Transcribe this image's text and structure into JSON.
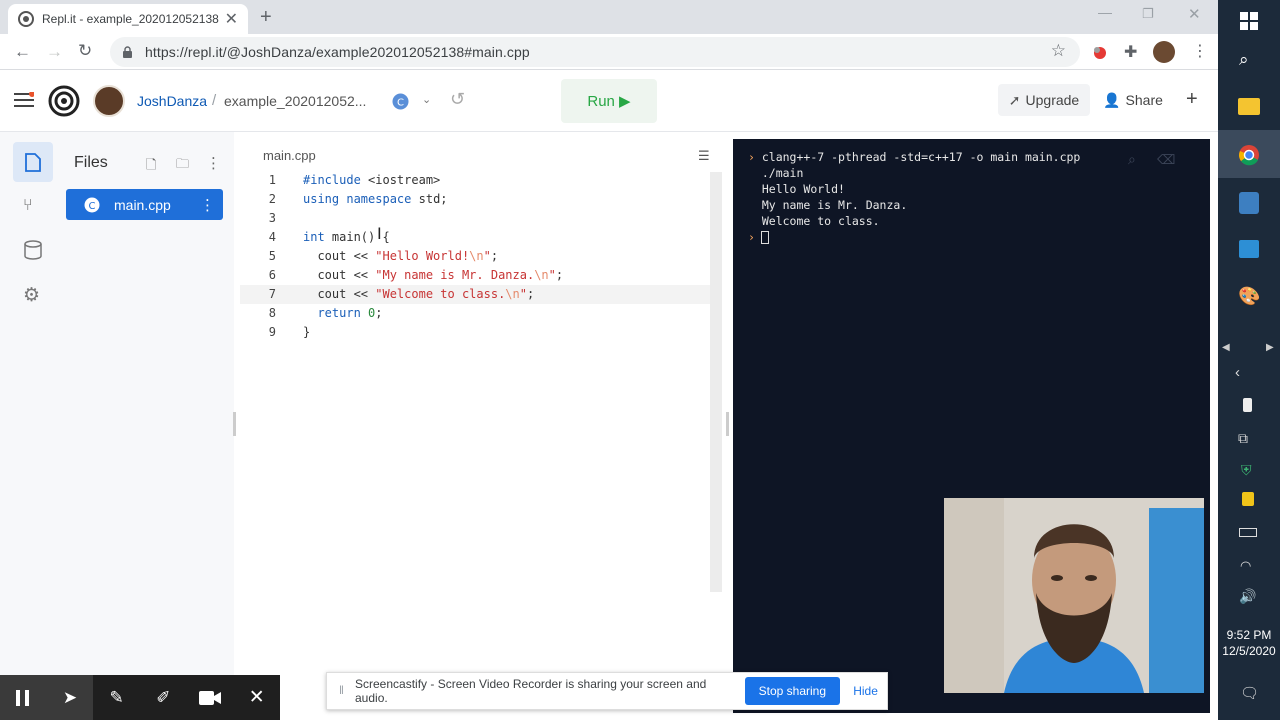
{
  "browser": {
    "tab_title": "Repl.it - example_202012052138",
    "url": "https://repl.it/@JoshDanza/example202012052138#main.cpp"
  },
  "header": {
    "username": "JoshDanza",
    "separator": "/",
    "repl_name": "example_202012052...",
    "run_label": "Run ▶",
    "upgrade_label": "Upgrade",
    "share_label": "Share",
    "add_symbol": "+"
  },
  "sidebar": {
    "files_title": "Files",
    "file_name": "main.cpp"
  },
  "editor": {
    "tab_label": "main.cpp",
    "active_line": 7,
    "lines": [
      {
        "n": "1",
        "text": "#include <iostream>"
      },
      {
        "n": "2",
        "text": "using namespace std;"
      },
      {
        "n": "3",
        "text": ""
      },
      {
        "n": "4",
        "text": "int main() {"
      },
      {
        "n": "5",
        "text": "  cout << \"Hello World!\\n\";"
      },
      {
        "n": "6",
        "text": "  cout << \"My name is Mr. Danza.\\n\";"
      },
      {
        "n": "7",
        "text": "  cout << \"Welcome to class.\\n\";"
      },
      {
        "n": "8",
        "text": "  return 0;"
      },
      {
        "n": "9",
        "text": "}"
      }
    ]
  },
  "console": {
    "lines": [
      {
        "prompt": true,
        "text": "clang++-7 -pthread -std=c++17 -o main main.cpp"
      },
      {
        "prompt": false,
        "text": "./main"
      },
      {
        "prompt": false,
        "text": "Hello World!"
      },
      {
        "prompt": false,
        "text": "My name is Mr. Danza."
      },
      {
        "prompt": false,
        "text": "Welcome to class."
      }
    ],
    "prompt_symbol": "›"
  },
  "screencastify": {
    "message": "Screencastify - Screen Video Recorder is sharing your screen and audio.",
    "stop_label": "Stop sharing",
    "hide_label": "Hide"
  },
  "taskbar": {
    "time": "9:52 PM",
    "date": "12/5/2020"
  },
  "colors": {
    "accent": "#1f6fd9",
    "run_green": "#28a745",
    "console_bg": "#0e1525"
  }
}
